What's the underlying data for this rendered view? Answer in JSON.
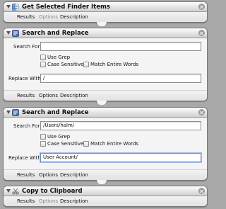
{
  "actions": [
    {
      "title": "Get Selected Finder Items",
      "icon": "finder-icon",
      "tabs": {
        "results": "Results",
        "options": "Options",
        "description": "Description"
      }
    },
    {
      "title": "Search and Replace",
      "icon": "automator-text-icon",
      "search_label": "Search For:",
      "search_value": "",
      "use_grep": "Use Grep",
      "case_sensitive": "Case Sensitive",
      "match_entire_words": "Match Entire Words",
      "replace_label": "Replace With:",
      "replace_value": "/",
      "tabs": {
        "results": "Results",
        "options": "Options",
        "description": "Description"
      }
    },
    {
      "title": "Search and Replace",
      "icon": "automator-text-icon",
      "search_label": "Search For:",
      "search_value": "/Users/halm/",
      "use_grep": "Use Grep",
      "case_sensitive": "Case Sensitive",
      "match_entire_words": "Match Entire Words",
      "replace_label": "Replace With:",
      "replace_value": "User Account/",
      "tabs": {
        "results": "Results",
        "options": "Options",
        "description": "Description"
      }
    },
    {
      "title": "Copy to Clipboard",
      "icon": "scissors-icon",
      "tabs": {
        "results": "Results",
        "options": "Options",
        "description": "Description"
      }
    }
  ],
  "colors": {
    "background": "#a9a9a9",
    "panel": "#f4f4f4",
    "dim_tab": "#8a8a8a",
    "focus_ring": "#9fbbe6"
  }
}
